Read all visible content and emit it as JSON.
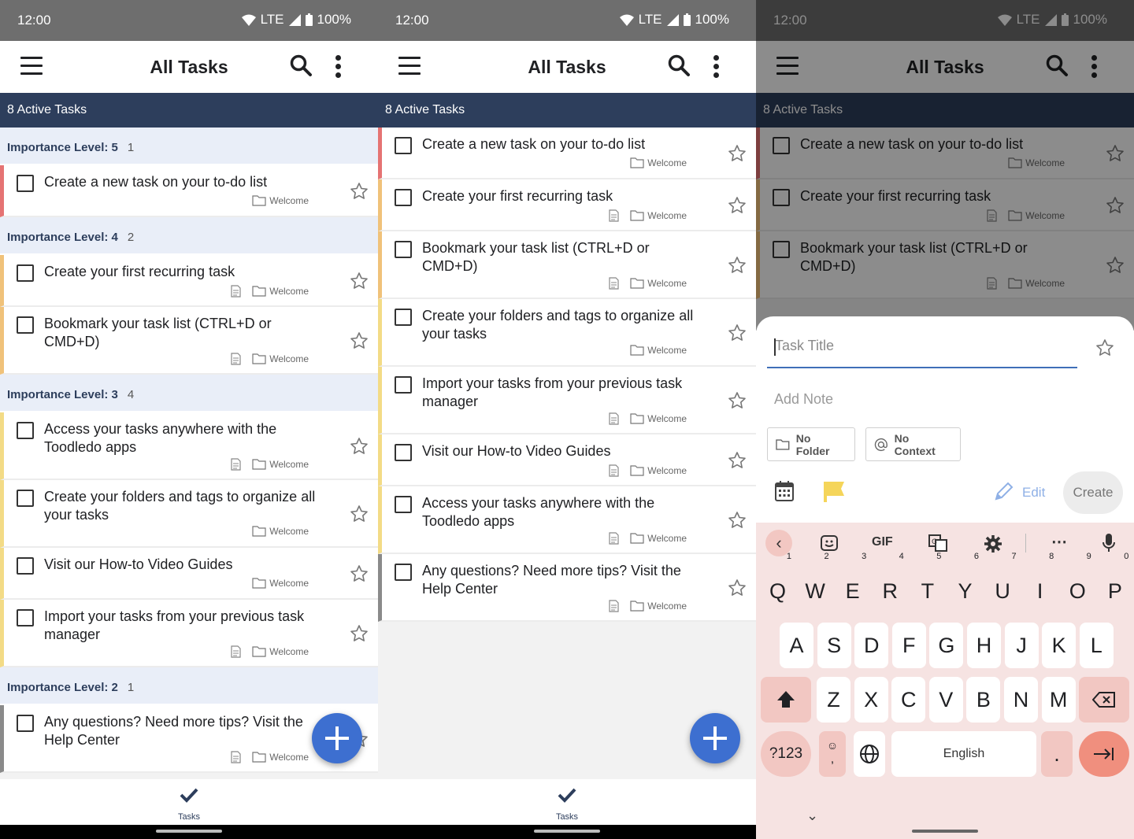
{
  "colors": {
    "accent": "#3d6fd0",
    "header": "#2d3e5c",
    "statusbar": "#6e6e6e",
    "importance5": "#e57373",
    "importance4": "#f0c27a",
    "importance3": "#f3db86",
    "importance2": "#8a8a8a",
    "keyboard": "#f6e3e2"
  },
  "status": {
    "time": "12:00",
    "network": "LTE",
    "battery": "100%"
  },
  "appbar": {
    "title": "All Tasks",
    "menu_icon": "hamburger-menu-icon",
    "search_icon": "search-icon",
    "more_icon": "more-vertical-icon"
  },
  "active_count": "8 Active Tasks",
  "folder": "Welcome",
  "panel1": {
    "groups": [
      {
        "label": "Importance Level: 5",
        "count": "1",
        "tasks": [
          {
            "title": "Create a new task on your to-do list",
            "note": false
          }
        ]
      },
      {
        "label": "Importance Level: 4",
        "count": "2",
        "tasks": [
          {
            "title": "Create your first recurring task",
            "note": true
          },
          {
            "title": "Bookmark your task list (CTRL+D or CMD+D)",
            "note": true
          }
        ]
      },
      {
        "label": "Importance Level: 3",
        "count": "4",
        "tasks": [
          {
            "title": "Access your tasks anywhere with the Toodledo apps",
            "note": true
          },
          {
            "title": "Create your folders and tags to organize all your tasks",
            "note": false
          },
          {
            "title": "Visit our How-to Video Guides",
            "note": false
          },
          {
            "title": "Import your tasks from your previous task manager",
            "note": true
          }
        ]
      },
      {
        "label": "Importance Level: 2",
        "count": "1",
        "tasks": [
          {
            "title": "Any questions? Need more tips? Visit the Help Center",
            "note": true
          }
        ]
      }
    ]
  },
  "panel2": {
    "tasks": [
      {
        "title": "Create a new task on your to-do list",
        "note": false,
        "level": "red"
      },
      {
        "title": "Create your first recurring task",
        "note": true,
        "level": "orange"
      },
      {
        "title": "Bookmark your task list (CTRL+D or CMD+D)",
        "note": true,
        "level": "orange"
      },
      {
        "title": "Create your folders and tags to organize all your tasks",
        "note": false,
        "level": "yellow"
      },
      {
        "title": "Import your tasks from your previous task manager",
        "note": true,
        "level": "yellow"
      },
      {
        "title": "Visit our How-to Video Guides",
        "note": true,
        "level": "yellow"
      },
      {
        "title": "Access your tasks anywhere with the Toodledo apps",
        "note": true,
        "level": "yellow"
      },
      {
        "title": "Any questions? Need more tips? Visit the Help Center",
        "note": true,
        "level": "grey"
      }
    ]
  },
  "panel3": {
    "tasks": [
      {
        "title": "Create a new task on your to-do list",
        "note": false,
        "level": "red"
      },
      {
        "title": "Create your first recurring task",
        "note": true,
        "level": "orange"
      },
      {
        "title": "Bookmark your task list (CTRL+D or CMD+D)",
        "note": true,
        "level": "orange"
      }
    ]
  },
  "bottomnav": {
    "label": "Tasks",
    "icon": "checkmark-icon"
  },
  "sheet": {
    "title_placeholder": "Task Title",
    "note_placeholder": "Add Note",
    "folder_chip": "No Folder",
    "context_chip": "No Context",
    "edit_label": "Edit",
    "create_label": "Create",
    "calendar_icon": "calendar-icon",
    "flag_icon": "flag-icon"
  },
  "keyboard": {
    "toolbar": [
      "chevron-left-icon",
      "emoji-sticker-icon",
      "GIF",
      "translate-icon",
      "gear-icon",
      "more-horizontal-icon",
      "microphone-icon"
    ],
    "gif_label": "GIF",
    "row1": [
      {
        "k": "Q",
        "n": "1"
      },
      {
        "k": "W",
        "n": "2"
      },
      {
        "k": "E",
        "n": "3"
      },
      {
        "k": "R",
        "n": "4"
      },
      {
        "k": "T",
        "n": "5"
      },
      {
        "k": "Y",
        "n": "6"
      },
      {
        "k": "U",
        "n": "7"
      },
      {
        "k": "I",
        "n": "8"
      },
      {
        "k": "O",
        "n": "9"
      },
      {
        "k": "P",
        "n": "0"
      }
    ],
    "row2": [
      "A",
      "S",
      "D",
      "F",
      "G",
      "H",
      "J",
      "K",
      "L"
    ],
    "row3": [
      "Z",
      "X",
      "C",
      "V",
      "B",
      "N",
      "M"
    ],
    "symbols": "?123",
    "comma": ",",
    "period": ".",
    "space": "English"
  }
}
